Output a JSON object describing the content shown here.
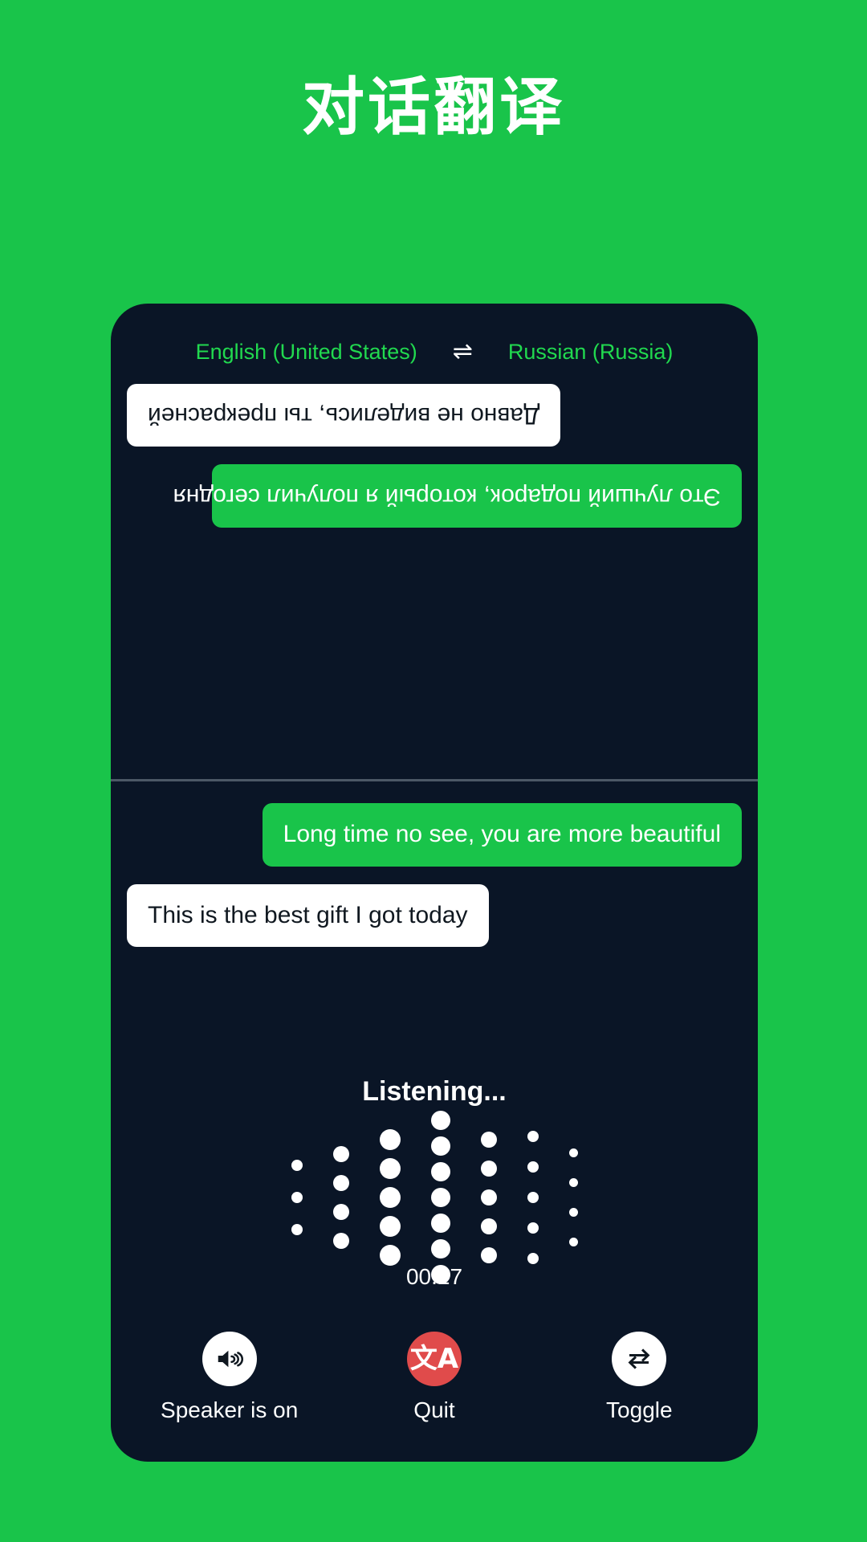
{
  "header": {
    "title": "对话翻译"
  },
  "colors": {
    "brand_green": "#19c44a",
    "panel_dark": "#0a1526",
    "accent_green_text": "#21d94f",
    "quit_red": "#e04b4b",
    "white": "#ffffff",
    "divider": "#4c5866"
  },
  "language_bar": {
    "source_language": "English (United States)",
    "swap_icon": "⇌",
    "swap_icon_name": "swap-languages-icon",
    "target_language": "Russian (Russia)"
  },
  "conversation": {
    "remote_pane": {
      "rotated": true,
      "messages": [
        {
          "text": "Это лучший подарок, который я получил сегодня",
          "style": "green",
          "align": "left"
        },
        {
          "text": "Давно не виделись, ты прекрасней",
          "style": "white",
          "align": "right"
        }
      ]
    },
    "local_pane": {
      "rotated": false,
      "messages": [
        {
          "text": "Long time no see, you are more beautiful",
          "style": "green",
          "align": "right"
        },
        {
          "text": "This is the best gift I got today",
          "style": "white",
          "align": "left"
        }
      ]
    }
  },
  "status": {
    "listening_label": "Listening...",
    "timer": "00:17"
  },
  "waveform": {
    "dot_color": "#ffffff",
    "columns": [
      {
        "count": 3,
        "size": 14,
        "gap": 26
      },
      {
        "count": 4,
        "size": 20,
        "gap": 16
      },
      {
        "count": 5,
        "size": 26,
        "gap": 10
      },
      {
        "count": 7,
        "size": 24,
        "gap": 8
      },
      {
        "count": 5,
        "size": 20,
        "gap": 16
      },
      {
        "count": 5,
        "size": 14,
        "gap": 24
      },
      {
        "count": 4,
        "size": 11,
        "gap": 26
      }
    ]
  },
  "controls": [
    {
      "label": "Speaker is on",
      "icon": "speaker-on-icon",
      "circle_style": "white",
      "name": "speaker-button"
    },
    {
      "label": "Quit",
      "icon": "translate-icon",
      "glyph": "文A",
      "circle_style": "red",
      "name": "quit-button"
    },
    {
      "label": "Toggle",
      "icon": "toggle-swap-icon",
      "circle_style": "white",
      "name": "toggle-button"
    }
  ]
}
